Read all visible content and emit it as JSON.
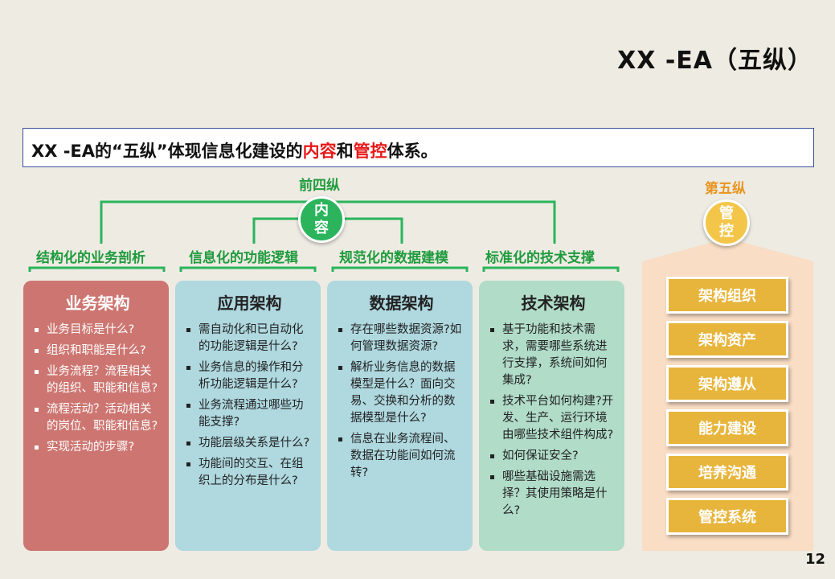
{
  "slide_title": "XX -EA（五纵）",
  "summary": {
    "prefix": "XX -EA的“五纵”体现信息化建设的",
    "highlight1": "内容",
    "middle": "和",
    "highlight2": "管控",
    "suffix": "体系。"
  },
  "group_label": "前四纵",
  "content_circle": "内容",
  "fifth_label": "第五纵",
  "control_circle": "管控",
  "columns": [
    {
      "header": "结构化的业务剖析",
      "title": "业务架构",
      "items": [
        "业务目标是什么?",
        "组织和职能是什么?",
        "业务流程？流程相关的组织、职能和信息?",
        "流程活动？活动相关的岗位、职能和信息?",
        "实现活动的步骤?"
      ]
    },
    {
      "header": "信息化的功能逻辑",
      "title": "应用架构",
      "items": [
        "需自动化和已自动化的功能逻辑是什么?",
        "业务信息的操作和分析功能逻辑是什么?",
        "业务流程通过哪些功能支撑?",
        "功能层级关系是什么?",
        "功能间的交互、在组织上的分布是什么?"
      ]
    },
    {
      "header": "规范化的数据建模",
      "title": "数据架构",
      "items": [
        "存在哪些数据资源?如何管理数据资源?",
        "解析业务信息的数据模型是什么？面向交易、交换和分析的数据模型是什么?",
        "信息在业务流程间、数据在功能间如何流转?"
      ]
    },
    {
      "header": "标准化的技术支撑",
      "title": "技术架构",
      "items": [
        "基于功能和技术需求，需要哪些系统进行支撑，系统间如何集成?",
        "技术平台如何构建?开发、生产、运行环境由哪些技术组件构成?",
        "如何保证安全?",
        "哪些基础设施需选择？其使用策略是什么?"
      ]
    }
  ],
  "control_items": [
    "架构组织",
    "架构资产",
    "架构遵从",
    "能力建设",
    "培养沟通",
    "管控系统"
  ],
  "page_number": "12",
  "colors": {
    "green": "#2bb45c",
    "red_card": "#cd7671",
    "blue_card": "#afd8df",
    "mint_card": "#b0dcc8",
    "gold": "#e8b53c",
    "highlight_red": "#e81818"
  }
}
